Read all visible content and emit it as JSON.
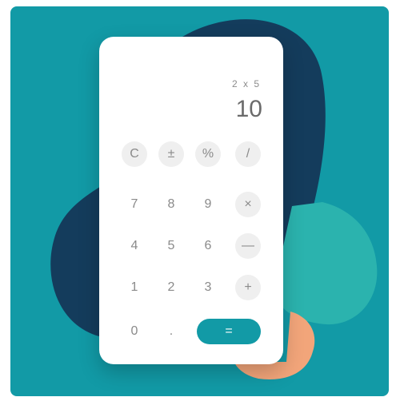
{
  "display": {
    "expression": "2 x 5",
    "result": "10"
  },
  "keys": [
    [
      "C",
      "±",
      "%",
      "/"
    ],
    [
      "7",
      "8",
      "9",
      "×"
    ],
    [
      "4",
      "5",
      "6",
      "—"
    ],
    [
      "1",
      "2",
      "3",
      "+"
    ],
    [
      "0",
      ".",
      "="
    ]
  ],
  "colors": {
    "background": "#129aa6",
    "accent": "#129aa6",
    "blob_navy": "#143c5c",
    "blob_aqua": "#2bb3ae",
    "blob_peach": "#f2a57a",
    "key_gray": "#efefef"
  }
}
